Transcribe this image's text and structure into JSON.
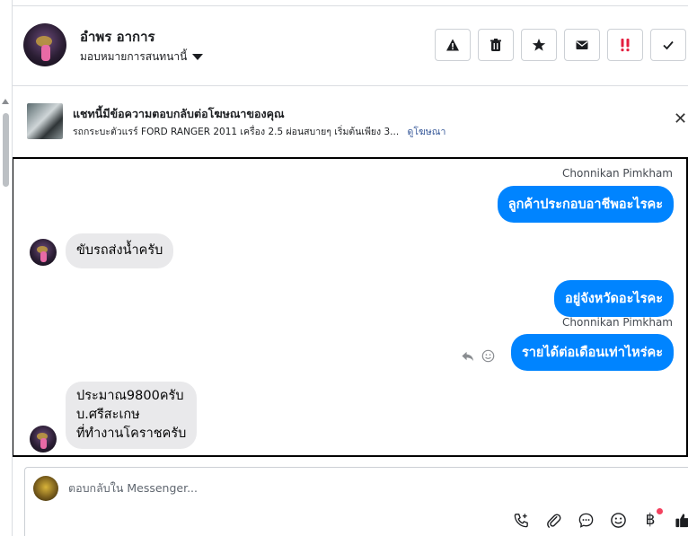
{
  "header": {
    "contact_name": "อำพร อาการ",
    "assign_label": "มอบหมายการสนทนานี้",
    "actions": [
      {
        "name": "report-spam-button",
        "icon": "warning-icon"
      },
      {
        "name": "delete-button",
        "icon": "trash-icon"
      },
      {
        "name": "star-button",
        "icon": "star-icon"
      },
      {
        "name": "mark-unread-button",
        "icon": "envelope-icon"
      },
      {
        "name": "follow-up-button",
        "icon": "double-exclamation-icon",
        "color": "#e41e3f"
      },
      {
        "name": "mark-done-button",
        "icon": "check-icon"
      }
    ]
  },
  "ad_banner": {
    "title": "แชทนี้มีข้อความตอบกลับต่อโฆษณาของคุณ",
    "description": "รถกระบะตัวแรร์ FORD RANGER 2011 เครื่อง 2.5 ผ่อนสบายๆ เริ่มต้นเพียง 3...",
    "link_label": "ดูโฆษณา",
    "close_icon": "close-icon"
  },
  "messages": [
    {
      "direction": "out",
      "sender": "Chonnikan Pimkham",
      "text": "ลูกค้าประกอบอาชีพอะไรคะ"
    },
    {
      "direction": "in",
      "text": "ขับรถส่งน้ำครับ"
    },
    {
      "direction": "out",
      "text": "อยู่จังหวัดอะไรคะ"
    },
    {
      "direction": "out",
      "sender": "Chonnikan Pimkham",
      "text": "รายได้ต่อเดือนเท่าไหร่คะ"
    },
    {
      "direction": "in",
      "lines": [
        "ประมาณ9800ครับ",
        "บ.ศรีสะเกษ",
        "ที่ทำงานโคราชครับ"
      ]
    }
  ],
  "composer": {
    "placeholder": "ตอบกลับใน Messenger...",
    "tools": [
      "phone-add-icon",
      "paperclip-icon",
      "chat-bubble-icon",
      "smiley-icon",
      "baht-icon",
      "thumbs-up-icon"
    ],
    "baht_symbol": "฿"
  },
  "colors": {
    "accent": "#0084ff",
    "incoming_bubble": "#e9e9eb",
    "notification_dot": "#f3425f"
  }
}
